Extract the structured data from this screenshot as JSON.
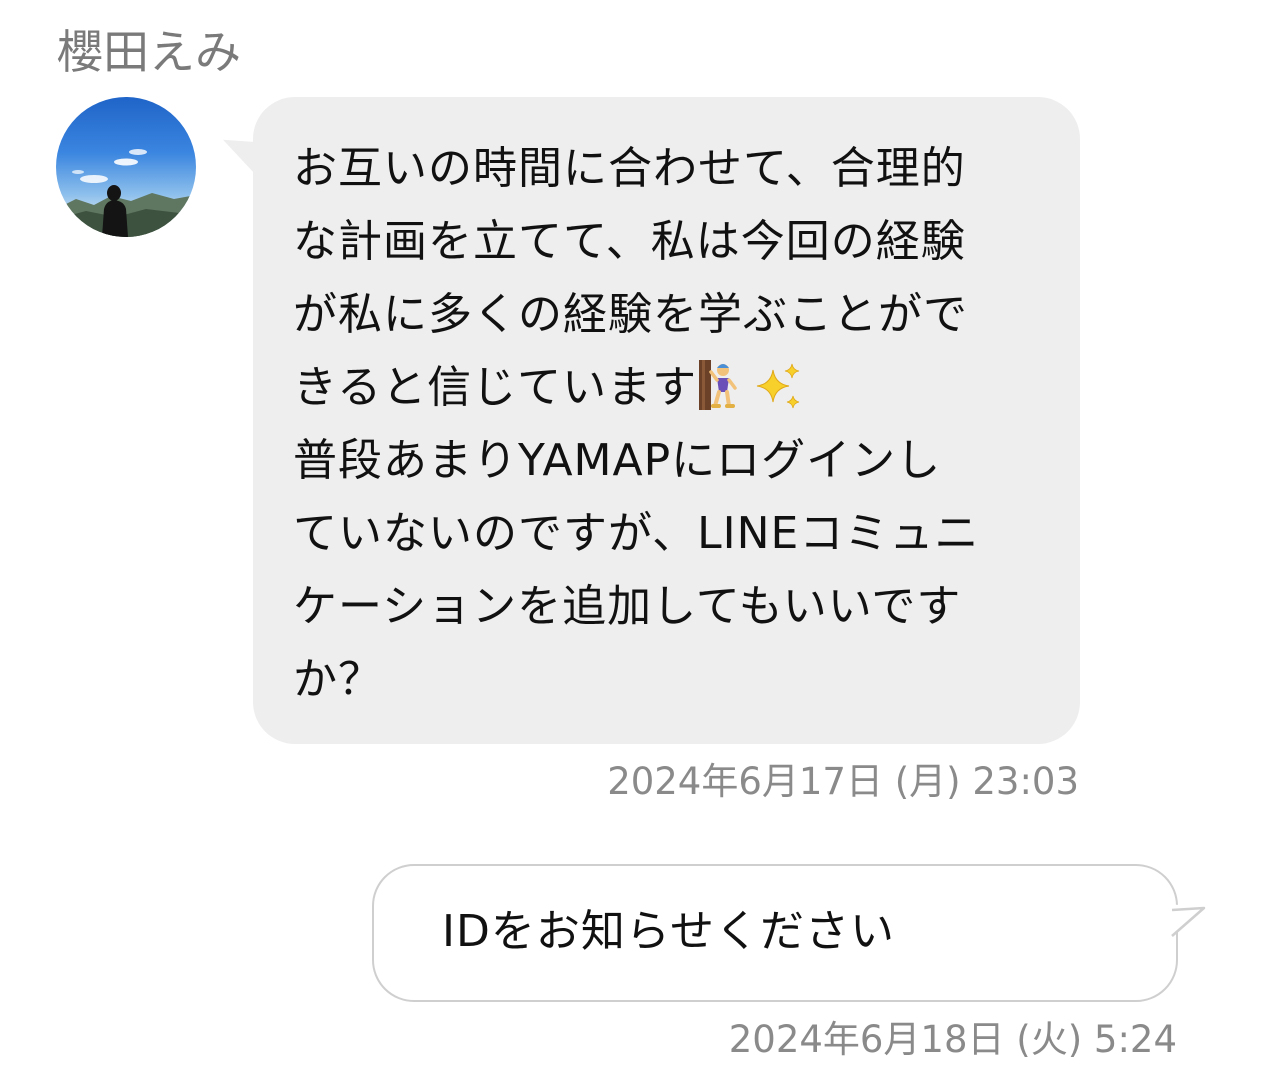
{
  "chat": {
    "sender_name": "櫻田えみ",
    "messages": [
      {
        "direction": "incoming",
        "text_lines": [
          "お互いの時間に合わせて、合理的",
          "な計画を立てて、私は今回の経験",
          "が私に多くの経験を学ぶことがで",
          "きると信じています",
          "普段あまりYAMAPにログインし",
          "ていないのですが、LINEコミュニ",
          "ケーションを追加してもいいです",
          "か？"
        ],
        "emojis": [
          "woman-climbing-emoji",
          "sparkles-emoji"
        ],
        "timestamp": "2024年6月17日 (月) 23:03"
      },
      {
        "direction": "outgoing",
        "text": "IDをお知らせください",
        "timestamp": "2024年6月18日 (火) 5:24"
      }
    ]
  },
  "colors": {
    "incoming_bubble": "#eeeeee",
    "outgoing_border": "#cfcfcf",
    "meta_text": "#8a8a8a"
  }
}
